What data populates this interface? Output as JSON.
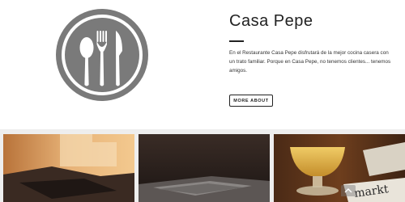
{
  "hero": {
    "logo_icon": "cutlery-icon",
    "title": "Casa Pepe",
    "description": "En el Restaurante Casa Pepe disfrutará de la mejor cocina casera con un trato familiar. Porque en Casa Pepe, no tenemos clientes... tenemos amigos.",
    "button_label": "MORE ABOUT"
  },
  "gallery": {
    "tiles": [
      {
        "icon": "restaurant-interior-photo"
      },
      {
        "icon": "laptop-photo"
      },
      {
        "icon": "beer-glass-photo",
        "sign_text": "markt"
      }
    ]
  },
  "scroll_top": {
    "icon": "chevron-up-icon"
  },
  "colors": {
    "logo_gray": "#7a7a7a",
    "text_dark": "#222222",
    "gallery_bg": "#eeeeee"
  }
}
